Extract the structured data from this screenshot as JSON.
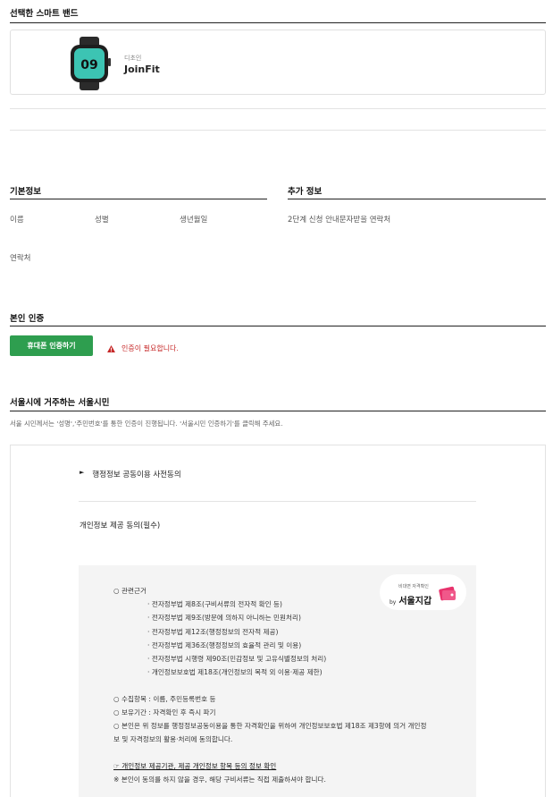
{
  "selected_band": {
    "title": "선택한 스마트 밴드",
    "brand": "디초인",
    "model": "JoinFit",
    "watch_face_number": "09"
  },
  "basic_info": {
    "title": "기본정보",
    "fields": [
      "이름",
      "성별",
      "생년월일"
    ],
    "contact_label": "연락처"
  },
  "additional_info": {
    "title": "추가 정보",
    "field": "2단계 신청 안내문자받을 연락처"
  },
  "identity": {
    "title": "본인 인증",
    "button_label": "휴대폰 인증하기",
    "warning": "인증이 필요합니다."
  },
  "seoul_citizen": {
    "title": "서울시에 거주하는 서울시민",
    "description": "서울 시민께서는 '성명','주민번호'를 통한 인증이 진행됩니다. '서울시민 인증하기'를 클릭해 주세요."
  },
  "consent": {
    "toggle_label": "행정정보 공동이용 사전동의",
    "toggle_marker": "►",
    "section_title": "개인정보 제공 동의(필수)",
    "basis_title": "○ 관련근거",
    "laws": [
      "· 전자정부법 제8조(구비서류의 전자적 확인 등)",
      "· 전자정부법 제9조(방문에 의하지 아니하는 민원처리)",
      "· 전자정부법 제12조(행정정보의 전자적 제공)",
      "· 전자정부법 제36조(행정정보의 효율적 관리 및 이용)",
      "· 전자정부법 시행령 제90조(민감정보 및 고유식별정보의 처리)",
      "· 개인정보보호법 제18조(개인정보의 목적 외 이용·제공 제한)"
    ],
    "items_line": "○ 수집항목 : 이름, 주민등록번호 등",
    "retention_line": "○ 보유기간 : 자격확인 후 즉시 파기",
    "agree_line_1": "○ 본인은 위 정보를 행정정보공동이용을 통한 자격확인을 위하여 개인정보보호법 제18조 제3항에 의거 개인정",
    "agree_line_2": "보 및 자격정보의 활용·처리에 동의합니다.",
    "link_text": "☞ 개인정보 제공기관, 제공 개인정보 항목 등의 정보 확인",
    "note": "※ 본인이 동의를 하지 않을 경우, 해당 구비서류는 직접 제출하셔야 합니다.",
    "badge_small": "비대면 자격확인",
    "badge_by": "by",
    "badge_main": "서울지갑"
  },
  "colors": {
    "button_green": "#2e9e4f",
    "warning_red": "#c62828",
    "badge_pink": "#e8336d"
  }
}
